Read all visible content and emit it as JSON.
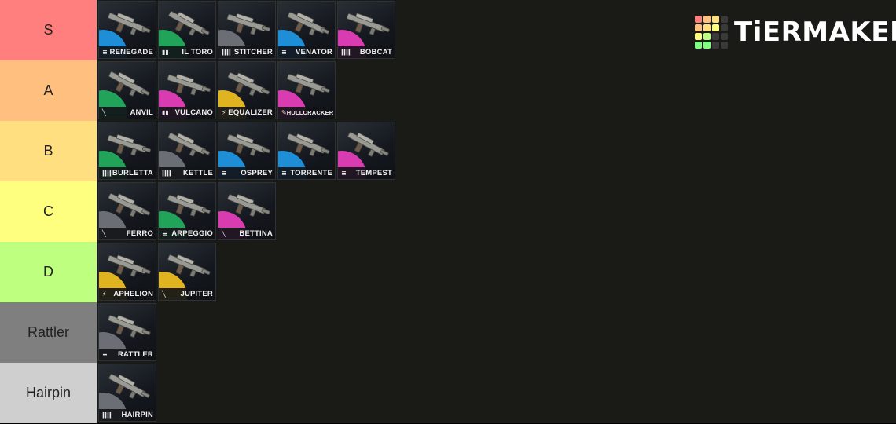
{
  "logo": {
    "text": "TiERMAKER",
    "grid_colors": [
      "#ff7f7f",
      "#ffbf7f",
      "#ffdf7f",
      "#3a3a3a",
      "#ffbf7f",
      "#ffdf7f",
      "#ffff7f",
      "#3a3a3a",
      "#ffff7f",
      "#bfff7f",
      "#3a3a3a",
      "#3a3a3a",
      "#7fff7f",
      "#7fff7f",
      "#3a3a3a",
      "#3a3a3a"
    ]
  },
  "rarity_colors": {
    "blue": "#1e8fd6",
    "green": "#22a35a",
    "pink": "#d93cb0",
    "gold": "#e0b320",
    "gray": "#6b6f75"
  },
  "tiers": [
    {
      "label": "S",
      "color": "#ff7f7f",
      "items": [
        {
          "name": "RENEGADE",
          "ammo_icon": "light-ammo-icon",
          "ammo": "≡",
          "rarity": "blue"
        },
        {
          "name": "IL TORO",
          "ammo_icon": "shotgun-ammo-icon",
          "ammo": "▮▮",
          "rarity": "green"
        },
        {
          "name": "STITCHER",
          "ammo_icon": "heavy-ammo-icon",
          "ammo": "ǀǀǀǀ",
          "rarity": "gray"
        },
        {
          "name": "VENATOR",
          "ammo_icon": "light-ammo-icon",
          "ammo": "≡",
          "rarity": "blue"
        },
        {
          "name": "BOBCAT",
          "ammo_icon": "heavy-ammo-icon",
          "ammo": "ǀǀǀǀ",
          "rarity": "pink"
        }
      ]
    },
    {
      "label": "A",
      "color": "#ffbf7f",
      "items": [
        {
          "name": "ANVIL",
          "ammo_icon": "sniper-ammo-icon",
          "ammo": "╲",
          "rarity": "green"
        },
        {
          "name": "VULCANO",
          "ammo_icon": "shotgun-ammo-icon",
          "ammo": "▮▮",
          "rarity": "pink"
        },
        {
          "name": "EQUALIZER",
          "ammo_icon": "energy-ammo-icon",
          "ammo": "⚡",
          "rarity": "gold"
        },
        {
          "name": "HULLCRACKER",
          "ammo_icon": "explosive-ammo-icon",
          "ammo": "✎",
          "rarity": "pink",
          "small": true
        }
      ]
    },
    {
      "label": "B",
      "color": "#ffdf7f",
      "items": [
        {
          "name": "BURLETTA",
          "ammo_icon": "heavy-ammo-icon",
          "ammo": "ǀǀǀǀ",
          "rarity": "green"
        },
        {
          "name": "KETTLE",
          "ammo_icon": "heavy-ammo-icon",
          "ammo": "ǀǀǀǀ",
          "rarity": "gray"
        },
        {
          "name": "OSPREY",
          "ammo_icon": "light-ammo-icon",
          "ammo": "≡",
          "rarity": "blue"
        },
        {
          "name": "TORRENTE",
          "ammo_icon": "light-ammo-icon",
          "ammo": "≡",
          "rarity": "blue"
        },
        {
          "name": "TEMPEST",
          "ammo_icon": "light-ammo-icon",
          "ammo": "≡",
          "rarity": "pink"
        }
      ]
    },
    {
      "label": "C",
      "color": "#ffff7f",
      "items": [
        {
          "name": "FERRO",
          "ammo_icon": "sniper-ammo-icon",
          "ammo": "╲",
          "rarity": "gray"
        },
        {
          "name": "ARPEGGIO",
          "ammo_icon": "light-ammo-icon",
          "ammo": "≡",
          "rarity": "green"
        },
        {
          "name": "BETTINA",
          "ammo_icon": "sniper-ammo-icon",
          "ammo": "╲",
          "rarity": "pink"
        }
      ]
    },
    {
      "label": "D",
      "color": "#bfff7f",
      "items": [
        {
          "name": "APHELION",
          "ammo_icon": "energy-ammo-icon",
          "ammo": "⚡",
          "rarity": "gold"
        },
        {
          "name": "JUPITER",
          "ammo_icon": "sniper-ammo-icon",
          "ammo": "╲",
          "rarity": "gold"
        }
      ]
    },
    {
      "label": "Rattler",
      "color": "#7f7f7f",
      "items": [
        {
          "name": "RATTLER",
          "ammo_icon": "light-ammo-icon",
          "ammo": "≡",
          "rarity": "gray"
        }
      ]
    },
    {
      "label": "Hairpin",
      "color": "#cfcfcf",
      "items": [
        {
          "name": "HAIRPIN",
          "ammo_icon": "heavy-ammo-icon",
          "ammo": "ǀǀǀǀ",
          "rarity": "gray"
        }
      ]
    }
  ]
}
